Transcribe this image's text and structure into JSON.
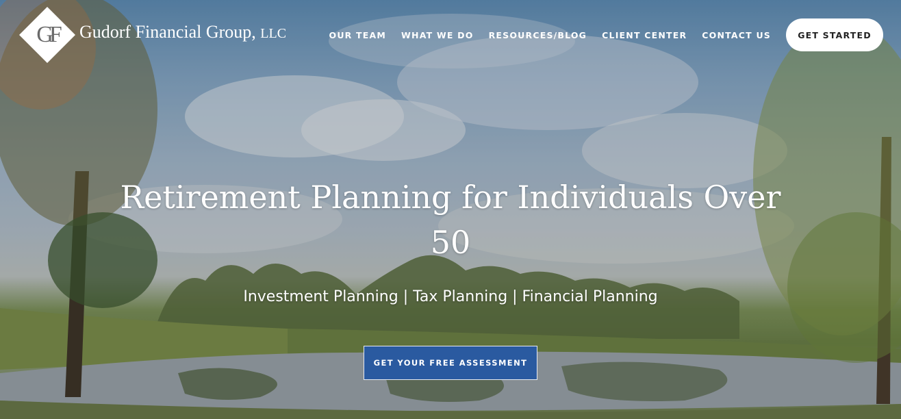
{
  "brand": {
    "monogram": "GF",
    "name": "Gudorf Financial Group,",
    "suffix": "LLC"
  },
  "nav": {
    "items": [
      {
        "label": "OUR TEAM"
      },
      {
        "label": "WHAT WE DO"
      },
      {
        "label": "RESOURCES/BLOG"
      },
      {
        "label": "CLIENT CENTER"
      },
      {
        "label": "CONTACT US"
      }
    ],
    "cta": "GET STARTED"
  },
  "hero": {
    "title": "Retirement Planning for Individuals Over 50",
    "subtitle": "Investment Planning | Tax Planning | Financial Planning",
    "cta": "GET YOUR FREE ASSESSMENT"
  },
  "colors": {
    "cta_blue": "#2a5aa0",
    "nav_text": "#ffffff",
    "cta_white": "#ffffff"
  }
}
